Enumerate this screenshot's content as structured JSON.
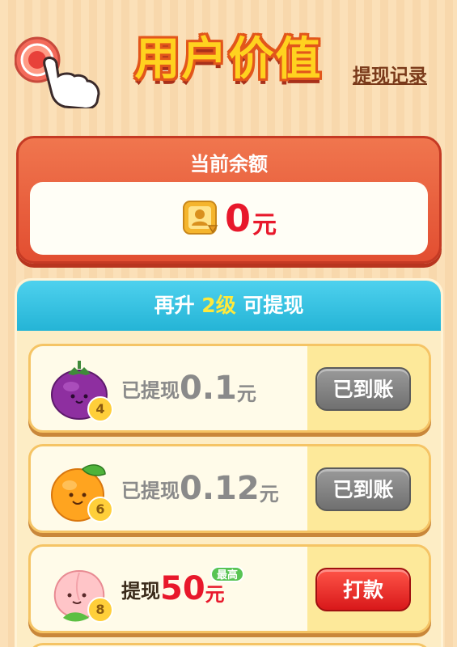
{
  "header": {
    "title": "用户价值",
    "history_link": "提现记录"
  },
  "balance": {
    "label": "当前余额",
    "amount": "0",
    "unit": "元"
  },
  "levels": {
    "header_prefix": "再升",
    "header_highlight": "2级",
    "header_suffix": "可提现",
    "rows": [
      {
        "fruit": "mangosteen-icon",
        "level": "4",
        "prefix": "已提现",
        "amount": "0.1",
        "unit": "元",
        "button": "已到账",
        "state": "done"
      },
      {
        "fruit": "orange-icon",
        "level": "6",
        "prefix": "已提现",
        "amount": "0.12",
        "unit": "元",
        "button": "已到账",
        "state": "done"
      },
      {
        "fruit": "peach-icon",
        "level": "8",
        "prefix": "提现",
        "amount": "50",
        "unit": "元",
        "badge": "最高",
        "button": "打款",
        "state": "active"
      }
    ]
  },
  "colors": {
    "accent_red": "#e8182b",
    "header_blue": "#24b4d6",
    "title_yellow": "#ffd21f"
  }
}
